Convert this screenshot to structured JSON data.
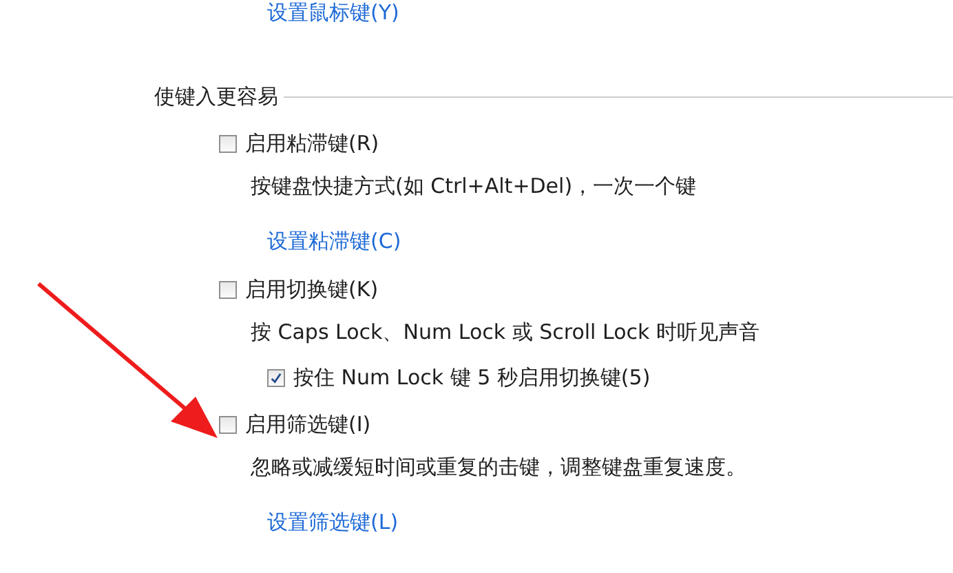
{
  "top_link": "设置鼠标键(Y)",
  "section": {
    "title": "使键入更容易",
    "items": [
      {
        "kind": "checkbox",
        "label": "启用粘滞键(R)",
        "checked": false
      },
      {
        "kind": "text",
        "text": "按键盘快捷方式(如 Ctrl+Alt+Del)，一次一个键"
      },
      {
        "kind": "link",
        "text": "设置粘滞键(C)"
      },
      {
        "kind": "checkbox",
        "label": "启用切换键(K)",
        "checked": false
      },
      {
        "kind": "text",
        "text": "按 Caps Lock、Num Lock 或 Scroll Lock 时听见声音"
      },
      {
        "kind": "subcheckbox",
        "label": "按住 Num Lock 键 5 秒启用切换键(5)",
        "checked": true
      },
      {
        "kind": "checkbox",
        "label": "启用筛选键(I)",
        "checked": false
      },
      {
        "kind": "text",
        "text": "忽略或减缓短时间或重复的击键，调整键盘重复速度。"
      },
      {
        "kind": "link",
        "text": "设置筛选键(L)"
      }
    ]
  }
}
